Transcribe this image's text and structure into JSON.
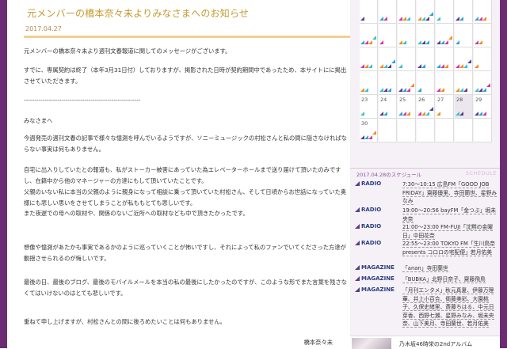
{
  "post": {
    "title": "元メンバーの橋本奈々未よりみなさまへのお知らせ",
    "date": "2017.04.27",
    "paragraphs": [
      "元メンバーの橋本奈々未より週刊文春報道に関してのメッセージがございます。",
      "すでに、専属契約は終了（本年3月31日付）しておりますが、掲影された日時が契約期間中であったため、本サイトにに掲出させていただきます。",
      "--------------------------------------------------------",
      "みなさまへ",
      "今週発売の週刊文春の記事で様々な憶測を呼んでいるようですが、ソニーミュージックの村松さんと私の間に隠さなければならない事実は何もありません。",
      "自宅に出入りしていたとの報道も、私がストーカー被害にあっていた為エレベーターホールまで送り届けて頂いたのみですし、在籍中から他のマネージャーの方達にもして頂いていたことです。",
      "父親のいない私に本当の父親のように親身になって相談に乗って頂いていた村松さん、そして日頃からお世話になっていた奥様にも悲しい思いをさせてしまうことが私ももとても悲しいです。\nまた夜遅での母への取材や、関係のないご近所への取材なども中で頂きたかったです。",
      "想像や憶測があたかも事実であるかのように巡っていくことが怖いですし、それによって私のファンでいてくださった方達が動揺させられるのが悔しいです。",
      "最後の日、最後のブログ、最後のモバイルメールを本当の私の最後にしたかったのですが、このような形でまた言葉を残さなくてはいけないのはとても悲しいです。",
      "重ねて申し上げますが、村松さんとの間に後ろめたいことは何もありません。"
    ],
    "signature": "橋本奈々未"
  },
  "calendar": {
    "rows": [
      [
        "",
        "",
        "",
        "",
        "",
        "",
        ""
      ],
      [
        "",
        "",
        "",
        "",
        "",
        "",
        ""
      ],
      [
        "",
        "",
        "",
        "",
        "",
        "",
        ""
      ],
      [
        "",
        "",
        "",
        "",
        "",
        "",
        ""
      ],
      [
        "23",
        "24",
        "25",
        "26",
        "27",
        "28",
        "29"
      ],
      [
        "30",
        "",
        "",
        "",
        "",
        "",
        ""
      ]
    ],
    "today": "28"
  },
  "schedule": {
    "date": "2017.04.28のスケジュール",
    "label": "SCHEDULE",
    "items": [
      {
        "category": "RADIO",
        "text": "7:30〜10:15 広島FM「GOOD JOB FRIDAY」齋藤優里、寺田蘭世、星野みなみ"
      },
      {
        "category": "RADIO",
        "text": "19:00〜20:56 bayFM「金つぶ」堀未央奈"
      },
      {
        "category": "RADIO",
        "text": "21:00〜23:00 FM-FUJI「沈黙の金曜日」中田花奈"
      },
      {
        "category": "RADIO",
        "text": "22:55〜23:00 TOKYO FM「生川鳥奈 presents コロロの宅配便」若月佑美"
      },
      {
        "category": "MAGAZINE",
        "text": "「anan」寺田蘭世"
      },
      {
        "category": "MAGAZINE",
        "text": "「BUBKA」北野日奈子、齋藤飛鳥"
      },
      {
        "category": "MAGAZINE",
        "text": "「月刊エンタメ」秋元真夏、伊藤万理華、井上小百合、衛藤美彩、大園桃子、久保史緒里、斎藤ちはる、中元日芽香、西野七瀬、星野みなみ、堀未央奈、山下美月、寺田蘭世、若月佑美"
      }
    ]
  },
  "promo": {
    "text": "乃木坂46時栄の2ndアルバム"
  },
  "colors": {
    "edge": "#6b2c74",
    "title": "#c59a2e",
    "rule": "#f1cf8f"
  }
}
